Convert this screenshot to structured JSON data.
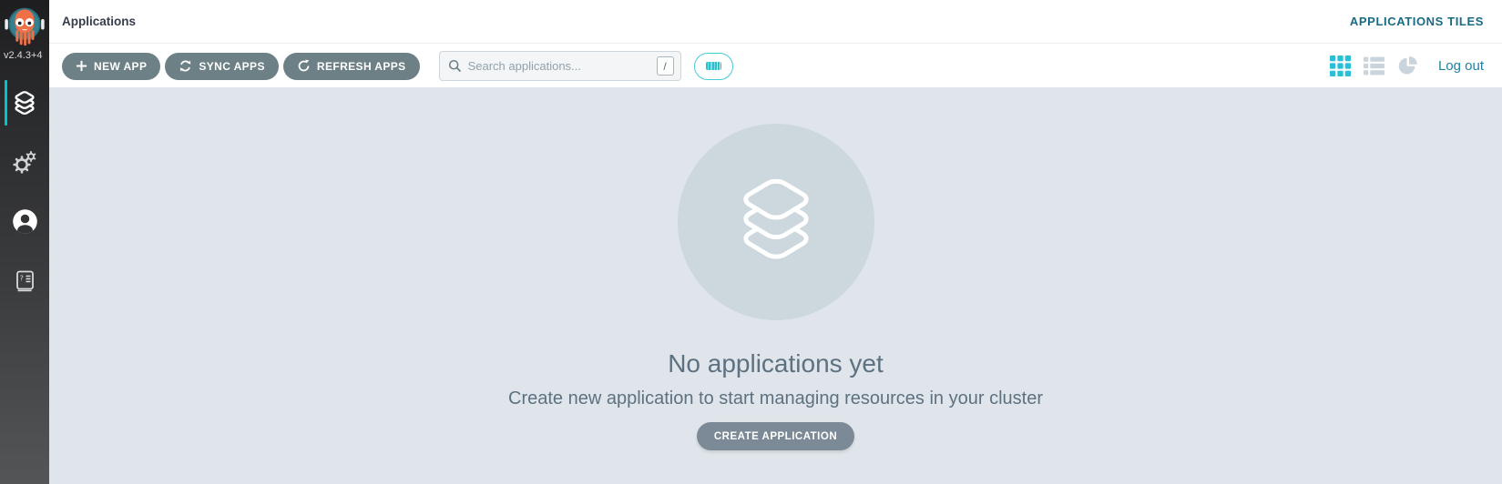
{
  "sidebar": {
    "version": "v2.4.3+4",
    "items": [
      {
        "label": "applications",
        "icon": "layers-icon",
        "active": true
      },
      {
        "label": "settings",
        "icon": "gear-icon",
        "active": false
      },
      {
        "label": "user-info",
        "icon": "user-icon",
        "active": false
      },
      {
        "label": "documentation",
        "icon": "help-book-icon",
        "active": false
      }
    ]
  },
  "header": {
    "breadcrumb": "Applications",
    "page_mode": "APPLICATIONS TILES"
  },
  "toolbar": {
    "new_app_label": "NEW APP",
    "sync_apps_label": "SYNC APPS",
    "refresh_apps_label": "REFRESH APPS",
    "search_placeholder": "Search applications...",
    "search_shortcut": "/",
    "logout_label": "Log out"
  },
  "empty_state": {
    "title": "No applications yet",
    "subtitle": "Create new application to start managing resources in your cluster",
    "cta_label": "CREATE APPLICATION"
  },
  "icons": {
    "logo": "argo-octopus-logo",
    "nav": [
      "layers-icon",
      "gear-icon",
      "user-icon",
      "help-book-icon"
    ],
    "toolbar": [
      "plus-icon",
      "sync-icon",
      "refresh-icon",
      "search-icon",
      "keyboard-bar-icon"
    ],
    "views": [
      "grid-view-icon",
      "list-view-icon",
      "pie-view-icon"
    ],
    "empty_state": "layers-icon"
  },
  "colors": {
    "accent_teal": "#00c2d4",
    "toggle_teal": "#2ac1cd",
    "slate_button": "#6d8086",
    "cta_button": "#7b8a96",
    "header_mode_text": "#176b84",
    "logout_link": "#1f82a5",
    "main_background": "#dfe5ea",
    "empty_circle": "#cdd7de",
    "sidebar_top": "#1e1e20",
    "sidebar_bottom": "#545557",
    "active_view_icon": "#27c0d8",
    "inactive_view_icon": "#c9d4dc"
  }
}
